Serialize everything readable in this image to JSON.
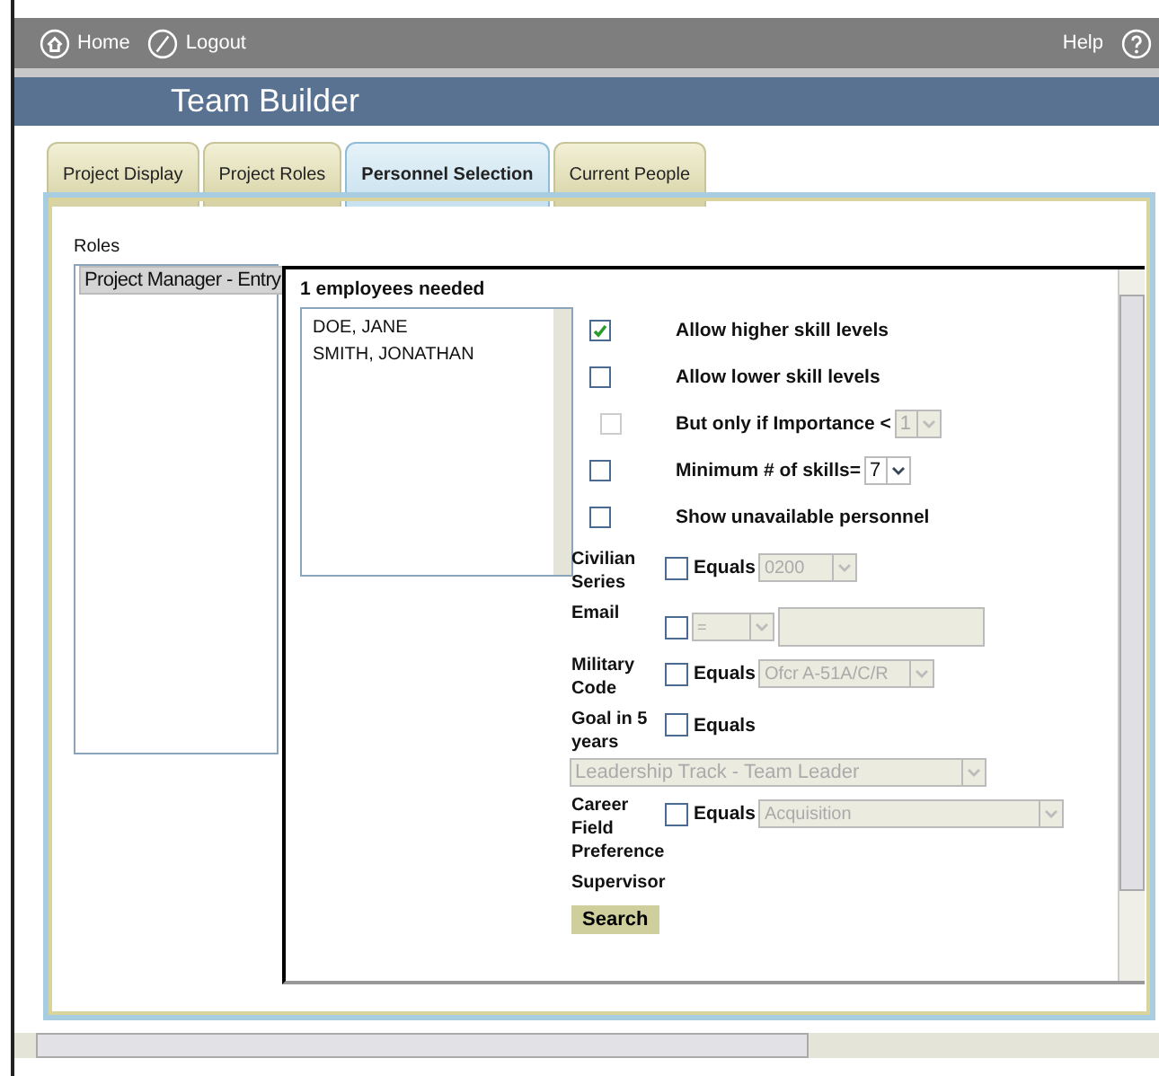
{
  "nav": {
    "links": [
      {
        "label": "Home",
        "kind": "home"
      },
      {
        "label": "Logout",
        "kind": "logout"
      }
    ],
    "help": "Help"
  },
  "app_title": "Team Builder",
  "tabs": [
    {
      "label": "Project Display",
      "selected": false
    },
    {
      "label": "Project Roles",
      "selected": false
    },
    {
      "label": "Personnel Selection",
      "selected": true
    },
    {
      "label": "Current People",
      "selected": false
    }
  ],
  "roles": {
    "label": "Roles",
    "items": [
      {
        "label": "Project Manager - Entry",
        "selected": true
      }
    ]
  },
  "selection": {
    "needed": "1 employees needed",
    "candidates": [
      "DOE, JANE",
      "SMITH, JONATHAN"
    ],
    "options": [
      {
        "label": "Allow higher skill levels",
        "checked": true,
        "disabled": false
      },
      {
        "label": "Allow lower skill levels",
        "checked": false,
        "disabled": false
      },
      {
        "label": "But only if Importance <",
        "checked": false,
        "disabled": true,
        "select": "1"
      },
      {
        "label": "Minimum # of skills=",
        "checked": false,
        "disabled": false,
        "select": "7"
      },
      {
        "label": "Show unavailable personnel",
        "checked": false,
        "disabled": false
      }
    ],
    "filters": [
      {
        "label": "Civilian Series",
        "kind": "inline",
        "checked": false,
        "operator": "Equals",
        "value": "0200"
      },
      {
        "label": "Email",
        "kind": "email",
        "checked": false,
        "operator": "="
      },
      {
        "label": "Military Code",
        "kind": "inline",
        "checked": false,
        "operator": "Equals",
        "value": "Ofcr A-51A/C/R"
      },
      {
        "label": "Goal in 5 years",
        "kind": "below",
        "checked": false,
        "operator": "Equals",
        "value": "Leadership Track - Team Leader"
      },
      {
        "label": "Career Field Preference",
        "kind": "inline",
        "checked": false,
        "operator": "Equals",
        "value": "Acquisition"
      }
    ],
    "supervisor_label": "Supervisor",
    "search_button": "Search"
  }
}
